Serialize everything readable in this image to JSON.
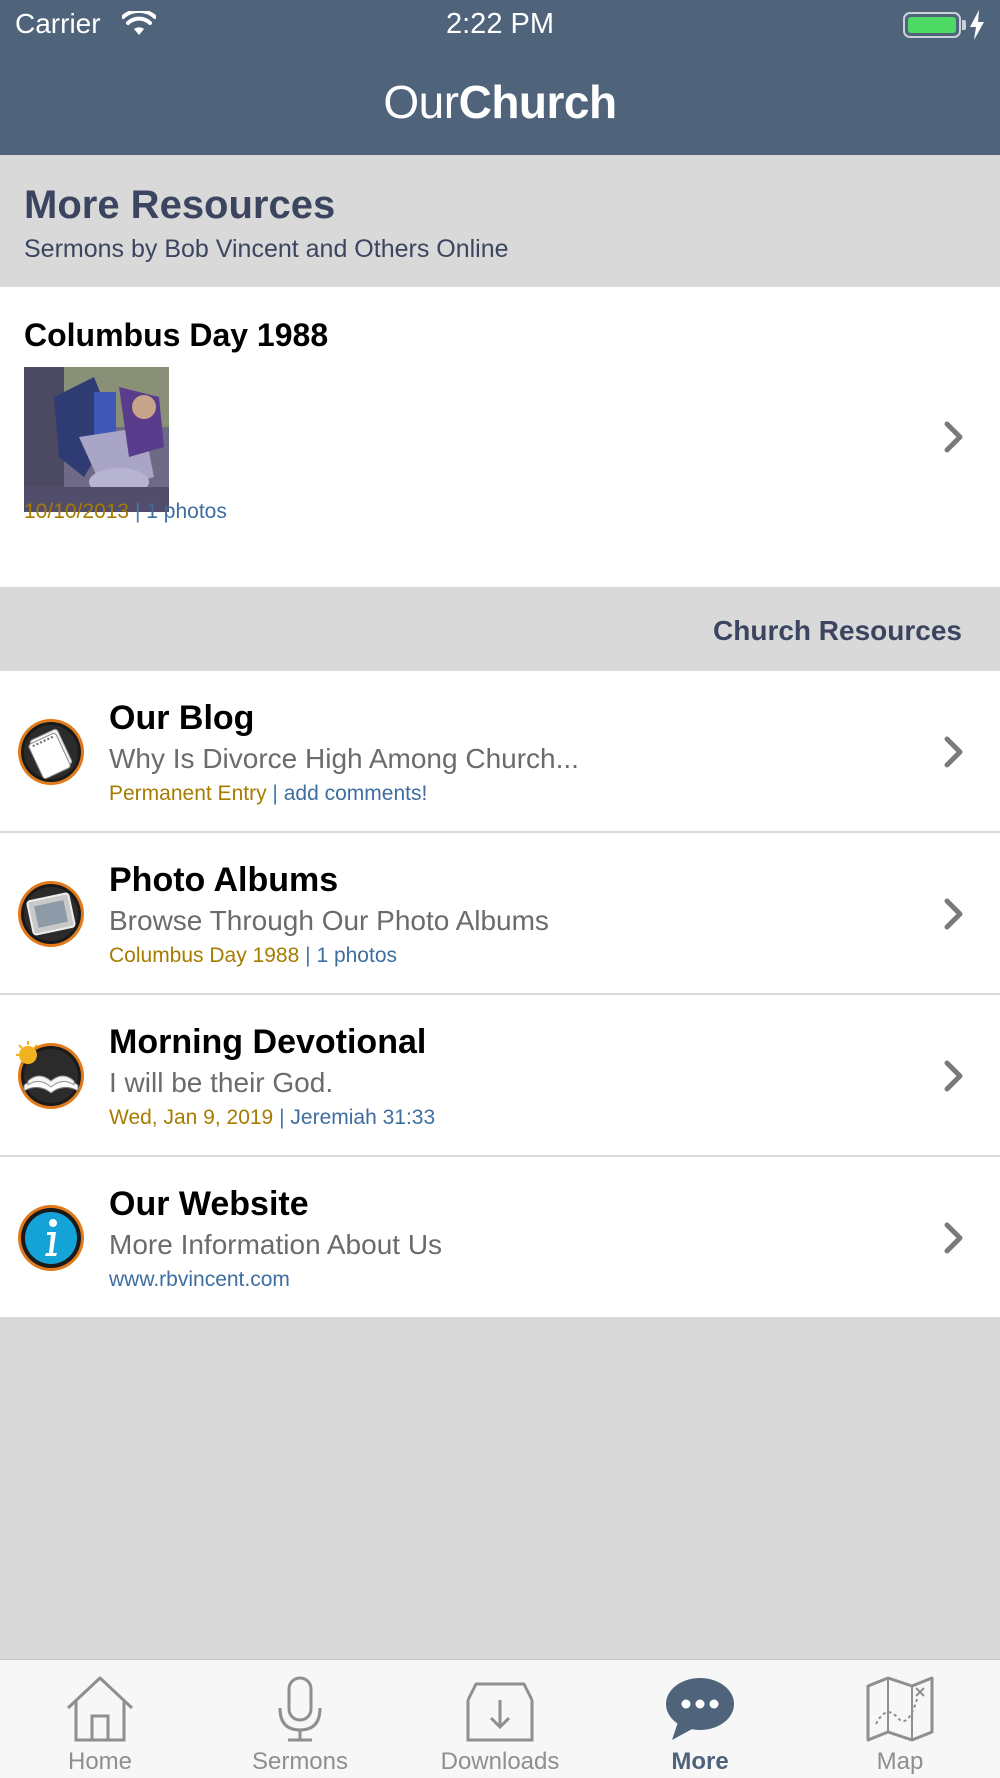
{
  "status_bar": {
    "carrier": "Carrier",
    "time": "2:22 PM"
  },
  "brand": {
    "light": "Our",
    "bold": "Church"
  },
  "header": {
    "title": "More Resources",
    "subtitle": "Sermons by Bob Vincent and Others Online"
  },
  "featured": {
    "title": "Columbus Day 1988",
    "date": "10/10/2013",
    "separator": "|",
    "count": "1 photos"
  },
  "section": {
    "title": "Church Resources"
  },
  "rows": [
    {
      "title": "Our Blog",
      "subtitle": "Why Is Divorce High Among Church...",
      "meta_left": "Permanent Entry",
      "separator": "|",
      "meta_right": "add comments!",
      "icon": "notepad-icon"
    },
    {
      "title": "Photo Albums",
      "subtitle": "Browse Through Our Photo Albums",
      "meta_left": "Columbus Day 1988",
      "separator": "|",
      "meta_right": "1 photos",
      "icon": "photo-frame-icon"
    },
    {
      "title": "Morning Devotional",
      "subtitle": "I will be their God.",
      "meta_left": "Wed, Jan 9, 2019",
      "separator": "|",
      "meta_right": "Jeremiah 31:33",
      "icon": "open-bible-sun-icon"
    },
    {
      "title": "Our Website",
      "subtitle": "More Information About Us",
      "meta_left": "",
      "separator": "",
      "meta_right": "www.rbvincent.com",
      "icon": "info-icon"
    }
  ],
  "tabs": [
    {
      "label": "Home",
      "icon": "home-icon",
      "active": false
    },
    {
      "label": "Sermons",
      "icon": "microphone-icon",
      "active": false
    },
    {
      "label": "Downloads",
      "icon": "download-tray-icon",
      "active": false
    },
    {
      "label": "More",
      "icon": "chat-bubble-icon",
      "active": true
    },
    {
      "label": "Map",
      "icon": "map-icon",
      "active": false
    }
  ],
  "colors": {
    "nav_bar": "#4f647b",
    "header_text": "#3b4560",
    "meta_date": "#a67c00",
    "meta_link": "#3e6ea0",
    "background": "#d9d9d9",
    "battery": "#4cd964"
  }
}
